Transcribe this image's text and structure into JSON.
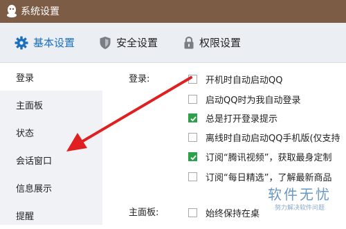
{
  "window": {
    "title": "系统设置"
  },
  "tabs": [
    {
      "label": "基本设置",
      "icon": "gear-icon",
      "active": true
    },
    {
      "label": "安全设置",
      "icon": "shield-icon",
      "active": false
    },
    {
      "label": "权限设置",
      "icon": "lock-icon",
      "active": false
    }
  ],
  "sidebar": {
    "items": [
      {
        "label": "登录",
        "active": true
      },
      {
        "label": "主面板",
        "active": false
      },
      {
        "label": "状态",
        "active": false
      },
      {
        "label": "会话窗口",
        "active": false
      },
      {
        "label": "信息展示",
        "active": false
      },
      {
        "label": "提醒",
        "active": false
      }
    ]
  },
  "login_section": {
    "label": "登录:",
    "options": [
      {
        "label": "开机时自动启动QQ",
        "checked": false
      },
      {
        "label": "启动QQ时为我自动登录",
        "checked": false
      },
      {
        "label": "总是打开登录提示",
        "checked": true
      },
      {
        "label": "离线时自动启动QQ手机版(仅支持",
        "checked": false
      },
      {
        "label": "订阅“腾讯视频”，获取最身定制",
        "checked": true
      },
      {
        "label": "订阅“每日精选”，了解最新商品",
        "checked": false
      }
    ]
  },
  "main_panel_section": {
    "label": "主面板:",
    "options": [
      {
        "label": "始终保持在桌",
        "checked": false
      }
    ]
  },
  "annotation": {
    "color": "#e02020"
  },
  "watermark": {
    "main": "软件无忧",
    "sub": "努力解决软件问题"
  },
  "colors": {
    "titlebar": "#7d5c45",
    "accent": "#1a6fc2",
    "checked": "#2da14a"
  }
}
